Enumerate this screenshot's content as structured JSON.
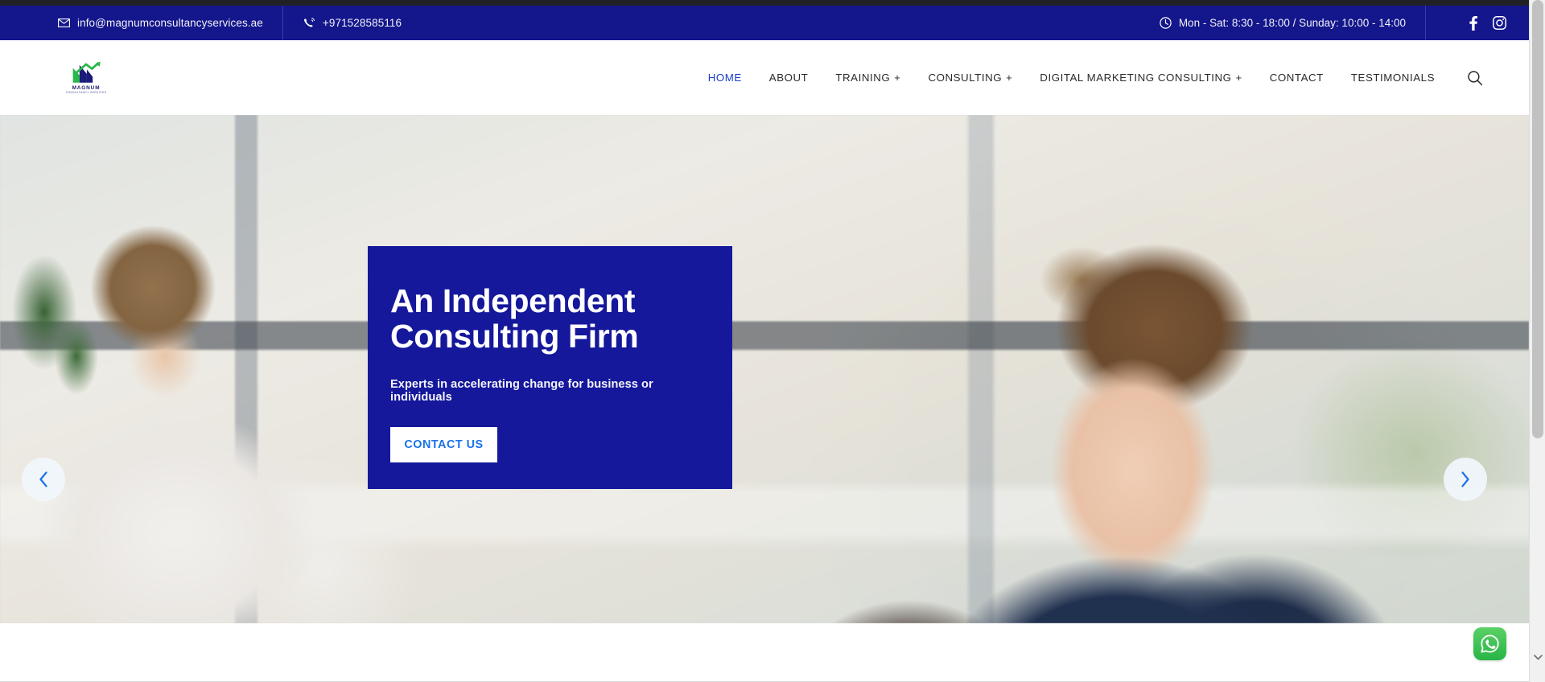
{
  "topbar": {
    "email": "info@magnumconsultancyservices.ae",
    "email_icon": "envelope-icon",
    "phone": "+971528585116",
    "phone_icon": "phone-ring-icon",
    "hours": "Mon - Sat: 8:30 - 18:00 / Sunday: 10:00 - 14:00",
    "hours_icon": "clock-icon",
    "social": [
      {
        "name": "facebook-icon",
        "label": "Facebook"
      },
      {
        "name": "instagram-icon",
        "label": "Instagram"
      }
    ],
    "bg_color": "#14168c"
  },
  "brand": {
    "logo_name": "MAGNUM",
    "logo_sub": "CONSULTANCY SERVICES",
    "logo_icon": "magnum-arrow-logo"
  },
  "nav": {
    "items": [
      {
        "label": "HOME",
        "has_dropdown": false,
        "active": true
      },
      {
        "label": "ABOUT",
        "has_dropdown": false,
        "active": false
      },
      {
        "label": "TRAINING",
        "has_dropdown": true,
        "active": false
      },
      {
        "label": "CONSULTING",
        "has_dropdown": true,
        "active": false
      },
      {
        "label": "DIGITAL MARKETING CONSULTING",
        "has_dropdown": true,
        "active": false
      },
      {
        "label": "CONTACT",
        "has_dropdown": false,
        "active": false
      },
      {
        "label": "TESTIMONIALS",
        "has_dropdown": false,
        "active": false
      }
    ],
    "dropdown_glyph": "+",
    "search_icon": "search-icon"
  },
  "hero": {
    "title_line1": "An Independent",
    "title_line2": "Consulting Firm",
    "subtitle": "Experts in accelerating change for business or individuals",
    "cta_label": "CONTACT US",
    "panel_color": "#15189b",
    "cta_text_color": "#1a73e8",
    "prev_icon": "chevron-left-icon",
    "next_icon": "chevron-right-icon",
    "image_alt": "Smiling businesswoman with glasses in navy blazer in a bright office, colleagues blurred in background"
  },
  "floating": {
    "whatsapp_label": "WhatsApp",
    "whatsapp_icon": "whatsapp-icon",
    "whatsapp_color": "#28b446"
  },
  "scrollbar": {
    "down_arrow_icon": "chevron-down-icon"
  }
}
